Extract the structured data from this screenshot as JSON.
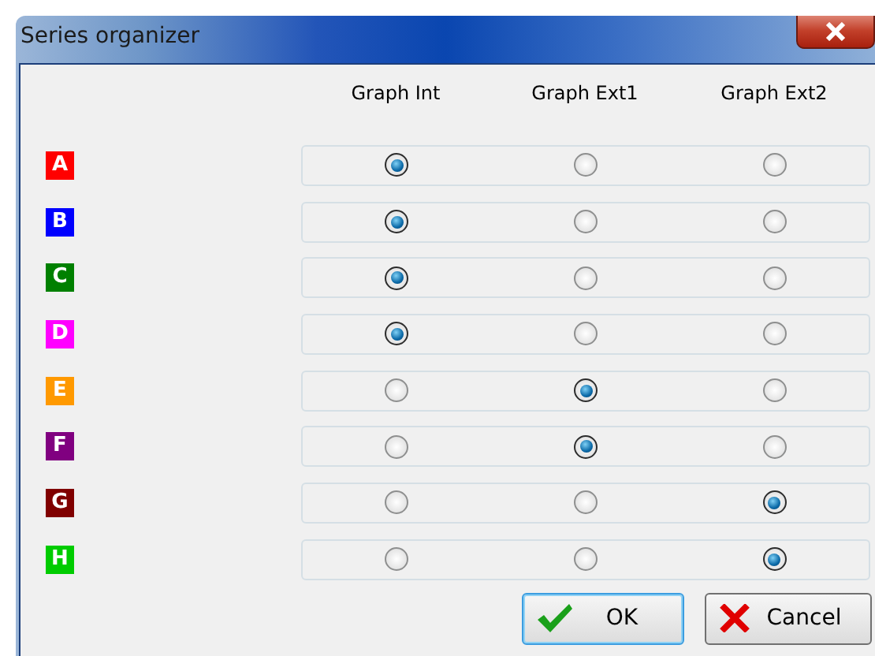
{
  "window": {
    "title": "Series organizer"
  },
  "columns": [
    "Graph Int",
    "Graph Ext1",
    "Graph Ext2"
  ],
  "series": [
    {
      "label": "A",
      "color": "#ff0000",
      "options": [
        {
          "selected": true
        },
        {
          "selected": false
        },
        {
          "selected": false
        }
      ]
    },
    {
      "label": "B",
      "color": "#0000ff",
      "options": [
        {
          "selected": true
        },
        {
          "selected": false
        },
        {
          "selected": false
        }
      ]
    },
    {
      "label": "C",
      "color": "#008000",
      "options": [
        {
          "selected": true
        },
        {
          "selected": false
        },
        {
          "selected": false
        }
      ]
    },
    {
      "label": "D",
      "color": "#ff00ff",
      "options": [
        {
          "selected": true
        },
        {
          "selected": false
        },
        {
          "selected": false
        }
      ]
    },
    {
      "label": "E",
      "color": "#ff9900",
      "options": [
        {
          "selected": false
        },
        {
          "selected": true
        },
        {
          "selected": false
        }
      ]
    },
    {
      "label": "F",
      "color": "#800080",
      "options": [
        {
          "selected": false
        },
        {
          "selected": true
        },
        {
          "selected": false
        }
      ]
    },
    {
      "label": "G",
      "color": "#800000",
      "options": [
        {
          "selected": false
        },
        {
          "selected": false
        },
        {
          "selected": true
        }
      ]
    },
    {
      "label": "H",
      "color": "#00cc00",
      "options": [
        {
          "selected": false
        },
        {
          "selected": false
        },
        {
          "selected": true
        }
      ]
    }
  ],
  "buttons": [
    {
      "label": "OK",
      "kind": "ok"
    },
    {
      "label": "Cancel",
      "kind": "cancel"
    }
  ]
}
